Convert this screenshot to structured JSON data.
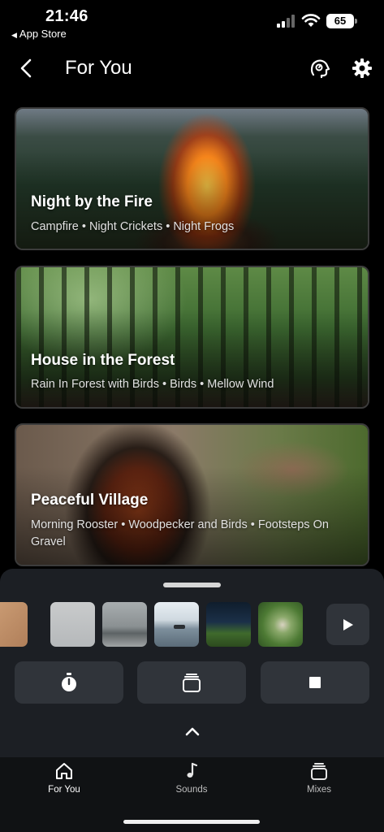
{
  "status_bar": {
    "time": "21:46",
    "back_app": "App Store",
    "battery": "65"
  },
  "header": {
    "title": "For You"
  },
  "cards": [
    {
      "title": "Night by the Fire",
      "subtitle": "Campfire • Night Crickets • Night Frogs"
    },
    {
      "title": "House in the Forest",
      "subtitle": "Rain In Forest with Birds • Birds • Mellow Wind"
    },
    {
      "title": "Peaceful Village",
      "subtitle": "Morning Rooster • Woodpecker and Birds • Footsteps On Gravel"
    }
  ],
  "player": {
    "thumbnails": [
      "wood-texture",
      "grey-sky",
      "misty-lake",
      "boat-on-water",
      "night-field",
      "bird-on-branch"
    ],
    "controls": [
      "timer",
      "mixes",
      "stop"
    ]
  },
  "tabs": [
    {
      "label": "For You",
      "icon": "home-icon",
      "active": true
    },
    {
      "label": "Sounds",
      "icon": "music-note-icon",
      "active": false
    },
    {
      "label": "Mixes",
      "icon": "stack-icon",
      "active": false
    }
  ],
  "colors": {
    "background": "#000000",
    "panel": "#1c1f24",
    "control": "#30343a",
    "tabbar": "#101214"
  }
}
